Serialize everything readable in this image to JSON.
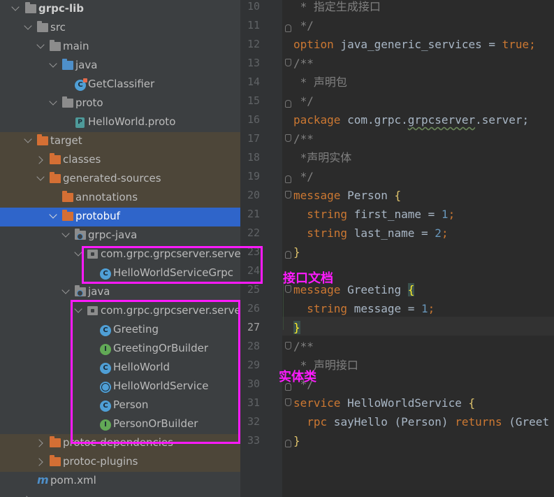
{
  "tree": {
    "rows": [
      {
        "id": "grpc-lib",
        "label": "grpc-lib",
        "bold": true
      },
      {
        "id": "src",
        "label": "src"
      },
      {
        "id": "main",
        "label": "main"
      },
      {
        "id": "java-src",
        "label": "java"
      },
      {
        "id": "getclassifier",
        "label": "GetClassifier"
      },
      {
        "id": "proto",
        "label": "proto"
      },
      {
        "id": "helloworld-proto",
        "label": "HelloWorld.proto"
      },
      {
        "id": "target",
        "label": "target"
      },
      {
        "id": "classes",
        "label": "classes"
      },
      {
        "id": "generated-sources",
        "label": "generated-sources"
      },
      {
        "id": "annotations",
        "label": "annotations"
      },
      {
        "id": "protobuf",
        "label": "protobuf"
      },
      {
        "id": "grpc-java",
        "label": "grpc-java"
      },
      {
        "id": "pkg1",
        "label": "com.grpc.grpcserver.server"
      },
      {
        "id": "helloworldservicegrpc",
        "label": "HelloWorldServiceGrpc"
      },
      {
        "id": "java-gen",
        "label": "java"
      },
      {
        "id": "pkg2",
        "label": "com.grpc.grpcserver.server"
      },
      {
        "id": "greeting",
        "label": "Greeting"
      },
      {
        "id": "greetingorbuilder",
        "label": "GreetingOrBuilder"
      },
      {
        "id": "helloworld",
        "label": "HelloWorld"
      },
      {
        "id": "helloworldservice",
        "label": "HelloWorldService"
      },
      {
        "id": "person",
        "label": "Person"
      },
      {
        "id": "personorbuilder",
        "label": "PersonOrBuilder"
      },
      {
        "id": "protoc-dependencies",
        "label": "protoc-dependencies"
      },
      {
        "id": "protoc-plugins",
        "label": "protoc-plugins"
      },
      {
        "id": "pom",
        "label": "pom.xml"
      }
    ]
  },
  "editor": {
    "line_numbers": [
      "10",
      "11",
      "12",
      "13",
      "14",
      "15",
      "16",
      "17",
      "18",
      "19",
      "20",
      "21",
      "22",
      "23",
      "24",
      "25",
      "26",
      "27",
      "28",
      "29",
      "30",
      "31",
      "32",
      "33"
    ],
    "current_line": "27",
    "lines": {
      "l10": " * 指定生成接口",
      "l11": " */",
      "l12a": "option",
      "l12b": " java_generic_services = ",
      "l12c": "true",
      "l12d": ";",
      "l13": "/**",
      "l14": " * 声明包",
      "l15": " */",
      "l16a": "package",
      "l16b": " com.grpc.",
      "l16c": "grpcserver",
      "l16d": ".server;",
      "l17": "/**",
      "l18": " *声明实体",
      "l19": " */",
      "l20a": "message",
      "l20b": " Person ",
      "l20c": "{",
      "l21a": "  string",
      "l21b": " first_name = ",
      "l21c": "1",
      "l21d": ";",
      "l22a": "  string",
      "l22b": " last_name = ",
      "l22c": "2",
      "l22d": ";",
      "l23": "}",
      "l25a": "message",
      "l25b": " Greeting ",
      "l25c": "{",
      "l26a": "  string",
      "l26b": " message = ",
      "l26c": "1",
      "l26d": ";",
      "l27": "}",
      "l28": "/**",
      "l29": " * 声明接口",
      "l30": " */",
      "l31a": "service",
      "l31b": " HelloWorldService ",
      "l31c": "{",
      "l32a": "  rpc",
      "l32b": " sayHello (Person) ",
      "l32c": "returns",
      "l32d": " (Greet",
      "l33": "}"
    }
  },
  "annotations": {
    "interface_doc": "接口文档",
    "entity_classes": "实体类"
  },
  "colors": {
    "highlight_box": "#ff1aff",
    "selection": "#2f65ca",
    "keyword": "#cc7832",
    "number": "#6897bb",
    "comment": "#808080"
  }
}
